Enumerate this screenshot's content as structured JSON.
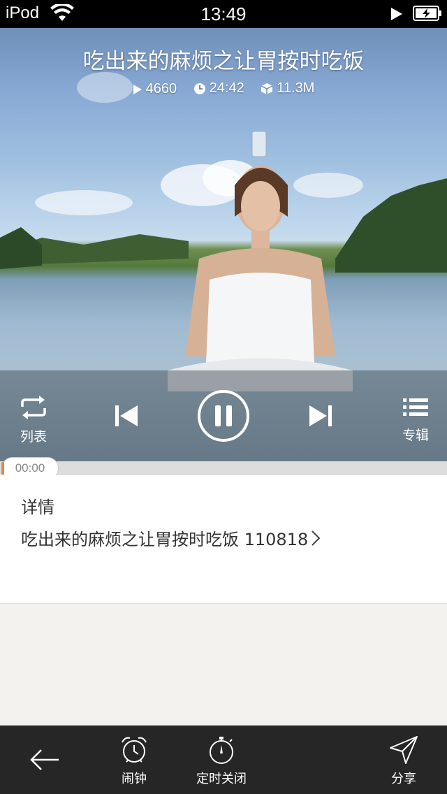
{
  "status_bar": {
    "carrier": "iPod",
    "time": "13:49"
  },
  "player": {
    "title": "吃出来的麻烦之让胃按时吃饭",
    "play_count": "4660",
    "duration": "24:42",
    "file_size": "11.3M",
    "current_time": "00:00",
    "progress": 0,
    "list_label": "列表",
    "album_label": "专辑"
  },
  "details": {
    "heading": "详情",
    "description": "吃出来的麻烦之让胃按时吃饭 110818"
  },
  "toolbar": {
    "alarm_label": "闹钟",
    "timer_label": "定时关闭",
    "share_label": "分享"
  },
  "icons": {
    "wifi": "wifi-icon",
    "battery": "battery-charging-icon",
    "repeat": "repeat-icon",
    "previous": "skip-previous-icon",
    "pause": "pause-icon",
    "next": "skip-next-icon",
    "album": "list-icon",
    "back": "back-arrow-icon",
    "alarm": "alarm-clock-icon",
    "timer": "stopwatch-icon",
    "share": "send-icon"
  }
}
